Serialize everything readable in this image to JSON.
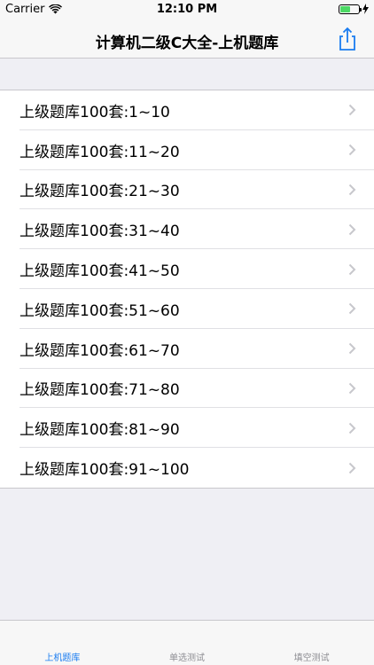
{
  "status_bar": {
    "carrier": "Carrier",
    "time": "12:10 PM",
    "battery_level": 0.55,
    "battery_color": "#4cd964"
  },
  "nav": {
    "title": "计算机二级C大全-上机题库",
    "share_icon": "share-icon"
  },
  "list": {
    "items": [
      {
        "label": "上级题库100套:1~10"
      },
      {
        "label": "上级题库100套:11~20"
      },
      {
        "label": "上级题库100套:21~30"
      },
      {
        "label": "上级题库100套:31~40"
      },
      {
        "label": "上级题库100套:41~50"
      },
      {
        "label": "上级题库100套:51~60"
      },
      {
        "label": "上级题库100套:61~70"
      },
      {
        "label": "上级题库100套:71~80"
      },
      {
        "label": "上级题库100套:81~90"
      },
      {
        "label": "上级题库100套:91~100"
      }
    ],
    "chevron_icon": "chevron-right-icon"
  },
  "tabs": [
    {
      "label": "上机题库",
      "active": true
    },
    {
      "label": "单选测试",
      "active": false
    },
    {
      "label": "填空测试",
      "active": false
    }
  ],
  "colors": {
    "accent": "#1a7cf0",
    "tab_inactive": "#8e8e93",
    "background": "#efeff4"
  }
}
